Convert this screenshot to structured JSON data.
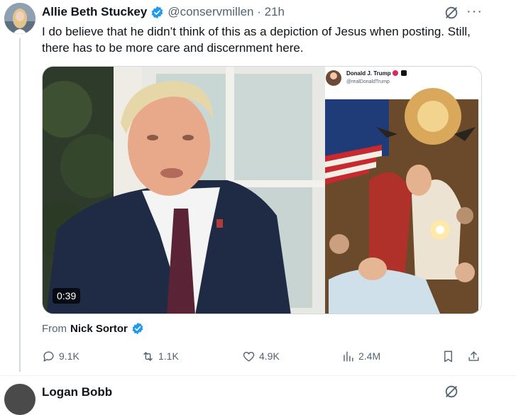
{
  "tweet": {
    "author_name": "Allie Beth Stuckey",
    "handle_time": "@conservmillen · 21h",
    "text": "I do believe that he didn’t think of this as a depiction of Jesus when posting. Still, there has to be more care and discernment here.",
    "video_duration": "0:39",
    "embedded_post": {
      "author_name": "Donald J. Trump",
      "handle": "@realDonaldTrump"
    },
    "from_label": "From",
    "from_source": "Nick Sortor",
    "stats": {
      "replies": "9.1K",
      "reposts": "1.1K",
      "likes": "4.9K",
      "views": "2.4M"
    }
  },
  "next_tweet": {
    "author_name": "Logan Bobb"
  },
  "colors": {
    "verified_blue": "#1d9bf0",
    "muted_text": "#536471",
    "border": "#cfd9de"
  }
}
